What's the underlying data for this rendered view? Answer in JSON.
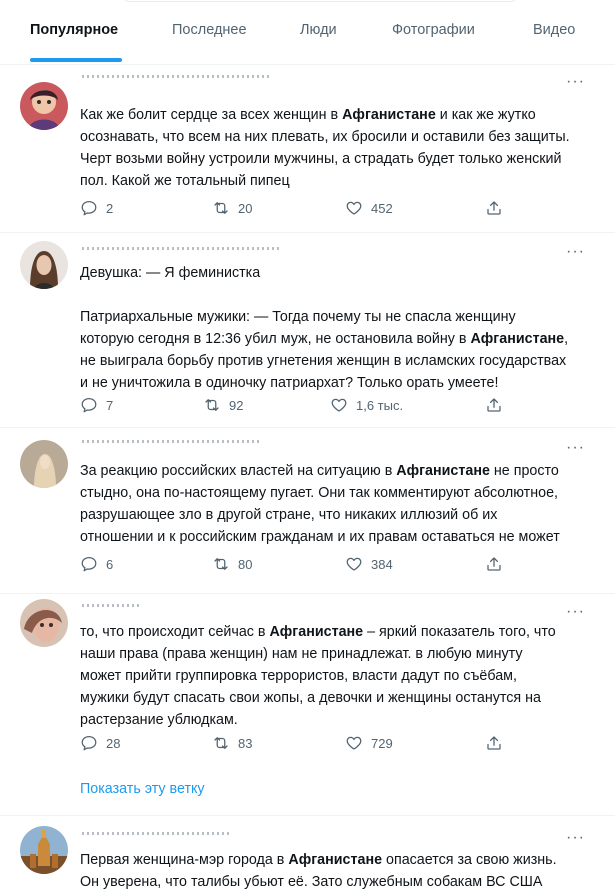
{
  "tabs": [
    {
      "label": "Популярное",
      "active": true
    },
    {
      "label": "Последнее"
    },
    {
      "label": "Люди"
    },
    {
      "label": "Фотографии"
    },
    {
      "label": "Видео"
    }
  ],
  "tweets": [
    {
      "pre": "Как же болит сердце за всех женщин в ",
      "keyword": "Афганистане",
      "post": " и как же жутко\nосознавать, что всем на них плевать, их бросили и оставили без защиты.\nЧерт возьми войну устроили мужчины, а страдать будет только женский\nпол. Какой же тотальный пипец",
      "replies": "2",
      "retweets": "20",
      "likes": "452"
    },
    {
      "pre": "Девушка: — Я феминистка\n\nПатриархальные мужики: — Тогда почему ты не спасла женщину\nкоторую сегодня в 12:36 убил муж, не остановила войну в ",
      "keyword": "Афганистане",
      "post": ",\nне выиграла борьбу против угнетения женщин в исламских государствах\nи не уничтожила в одиночку патриархат? Только орать умеете!",
      "replies": "7",
      "retweets": "92",
      "likes": "1,6 тыс."
    },
    {
      "pre": "За реакцию российских властей на ситуацию в ",
      "keyword": "Афганистане",
      "post": " не просто\nстыдно, она по-настоящему пугает. Они так комментируют абсолютное,\nразрушающее зло в другой стране, что никаких иллюзий об их\nотношении и к российским гражданам и их правам оставаться не может",
      "replies": "6",
      "retweets": "80",
      "likes": "384"
    },
    {
      "pre": "то, что происходит сейчас в ",
      "keyword": "Афганистане",
      "post": " – яркий показатель того, что\nнаши права (права женщин) нам не принадлежат. в любую минуту\nможет прийти группировка террористов, власти дадут по съёбам,\nмужики будут спасать свои жопы, а девочки и женщины останутся на\nрастерзание ублюдкам.",
      "replies": "28",
      "retweets": "83",
      "likes": "729",
      "thread_link": "Показать эту ветку"
    },
    {
      "pre": "Первая женщина-мэр города в ",
      "keyword": "Афганистане",
      "post": " опасается за свою жизнь.\nОн уверена, что талибы убьют её. Зато служебным собакам ВС США"
    }
  ],
  "colors": {
    "accent": "#1d9bf0",
    "muted": "#536471",
    "text": "#0f1419",
    "divider": "#eff3f4"
  }
}
